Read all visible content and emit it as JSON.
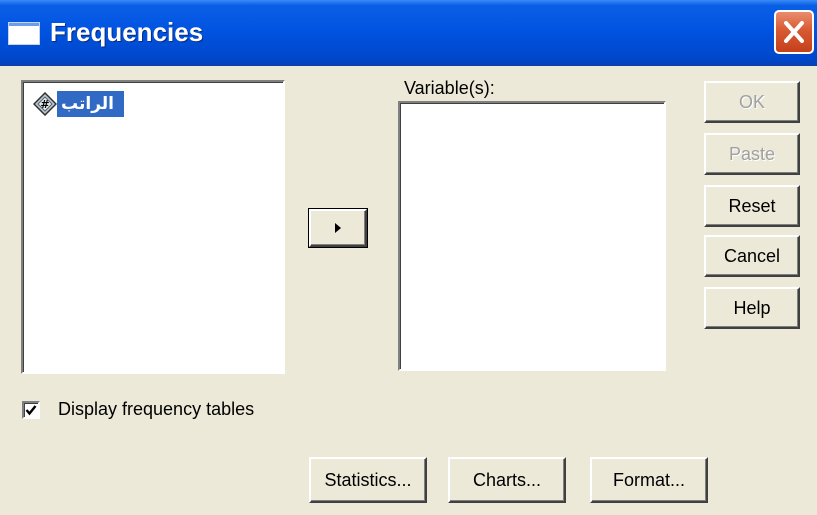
{
  "window": {
    "title": "Frequencies",
    "title_icon": "window-icon",
    "close_icon": "close-icon"
  },
  "source_list": {
    "items": [
      {
        "label": "الراتب",
        "icon": "numeric-variable-icon",
        "selected": true
      }
    ]
  },
  "target_list": {
    "label": "Variable(s):",
    "items": []
  },
  "move_button": {
    "icon": "right-arrow-icon"
  },
  "buttons": {
    "ok": "OK",
    "paste": "Paste",
    "reset": "Reset",
    "cancel": "Cancel",
    "help": "Help"
  },
  "options": {
    "display_frequency_tables": {
      "label": "Display frequency tables",
      "checked": true
    }
  },
  "bottom_buttons": {
    "statistics": "Statistics...",
    "charts": "Charts...",
    "format": "Format..."
  },
  "colors": {
    "titlebar": "#0052e0",
    "selection": "#316ac5",
    "dialog_bg": "#ece9d8",
    "close_button": "#d85a32"
  }
}
